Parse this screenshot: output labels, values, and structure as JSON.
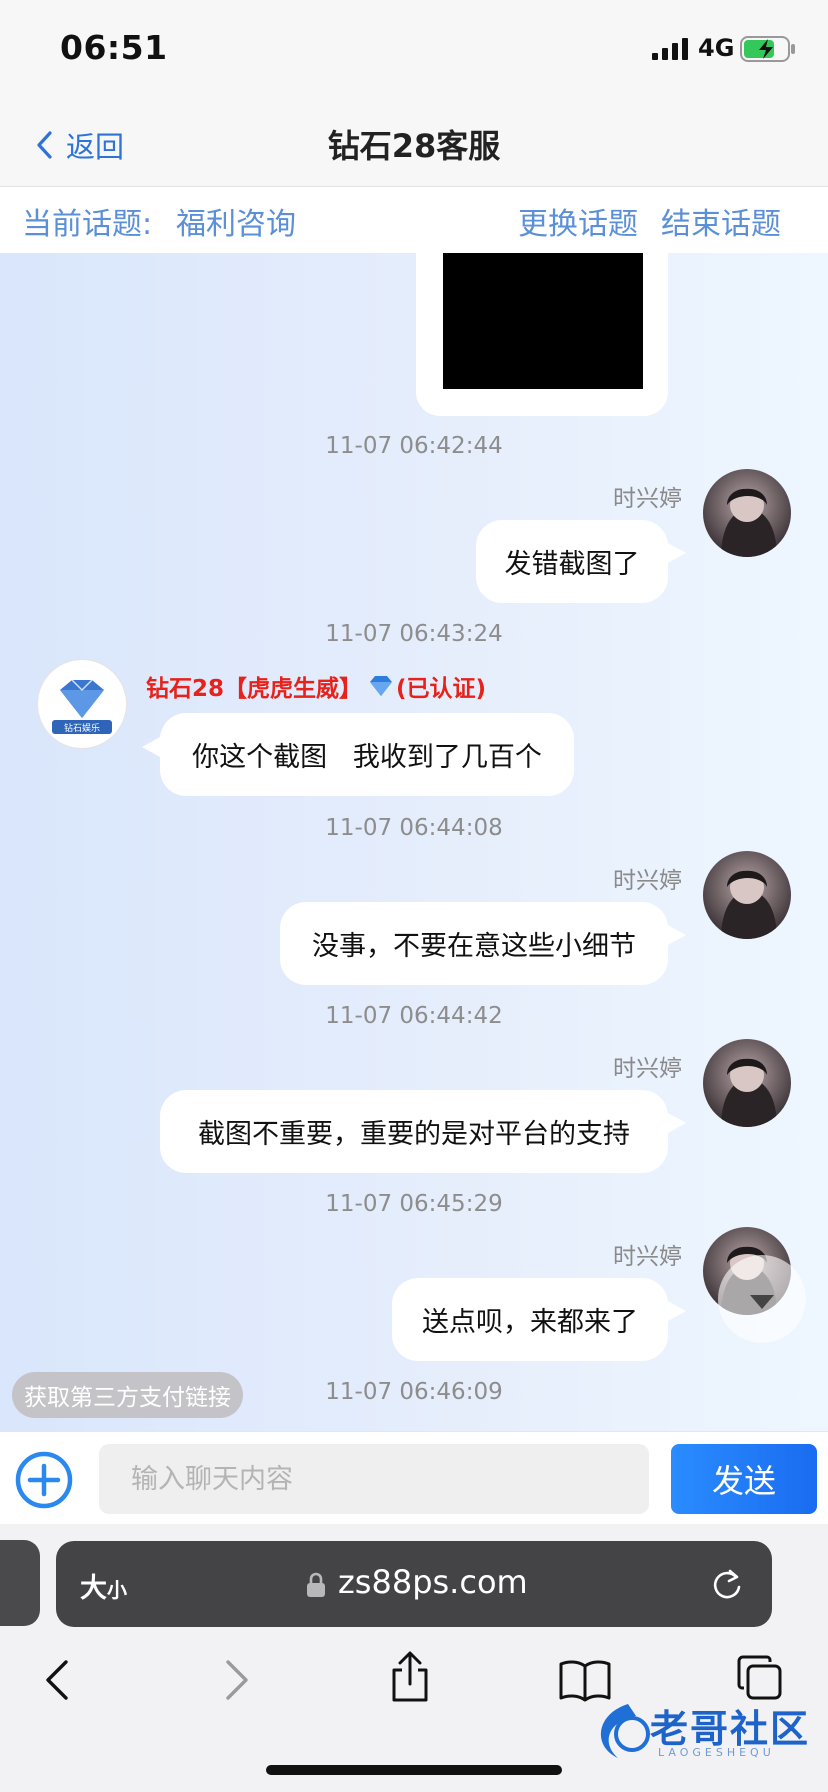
{
  "status_bar": {
    "time": "06:51",
    "network": "4G"
  },
  "nav": {
    "back_label": "返回",
    "title": "钻石28客服"
  },
  "topic_bar": {
    "label": "当前话题:",
    "value": "福利咨询",
    "change": "更换话题",
    "end": "结束话题"
  },
  "messages": [
    {
      "timestamp": "11-07 06:42:44",
      "sender": "时兴婷",
      "text": "发错截图了"
    },
    {
      "timestamp": "11-07 06:43:24",
      "sender": "钻石28【虎虎生威】",
      "verified": "(已认证)",
      "text": "你这个截图   我收到了几百个"
    },
    {
      "timestamp": "11-07 06:44:08",
      "sender": "时兴婷",
      "text": "没事，不要在意这些小细节"
    },
    {
      "timestamp": "11-07 06:44:42",
      "sender": "时兴婷",
      "text": "截图不重要，重要的是对平台的支持"
    },
    {
      "timestamp": "11-07 06:45:29",
      "sender": "时兴婷",
      "text": "送点呗，来都来了"
    },
    {
      "timestamp": "11-07 06:46:09"
    }
  ],
  "quick_action": "获取第三方支付链接",
  "input": {
    "placeholder": "输入聊天内容",
    "value": "",
    "send_label": "发送"
  },
  "browser": {
    "text_size_big": "大",
    "text_size_small": "小",
    "url": "zs88ps.com"
  },
  "watermark": {
    "text": "老哥社区",
    "sub": "LAOGESHEQU"
  },
  "colors": {
    "link": "#2d73d8",
    "topic": "#5b8fd8",
    "verified_red": "#e8221a",
    "send": "#1f7ef7"
  },
  "icons": [
    "back-chevron-icon",
    "signal-icon",
    "battery-charging-icon",
    "diamond-icon",
    "plus-circle-icon",
    "lock-icon",
    "reload-icon",
    "back-arrow-icon",
    "forward-arrow-icon",
    "share-icon",
    "bookmarks-icon",
    "tabs-icon"
  ]
}
